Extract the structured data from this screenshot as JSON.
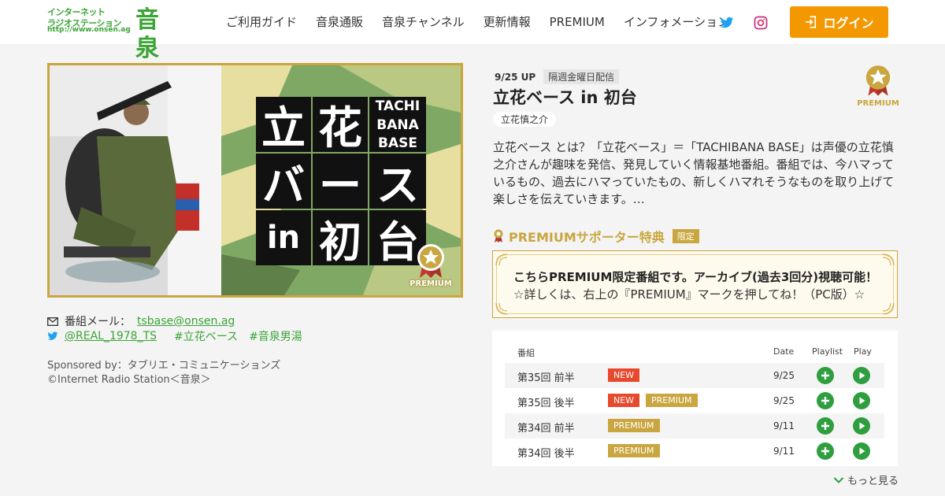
{
  "header": {
    "logo_line1": "インターネット",
    "logo_line2": "ラジオステーション",
    "logo_url": "http://www.onsen.ag",
    "logo_big": "音泉",
    "nav": [
      "ご利用ガイド",
      "音泉通販",
      "音泉チャンネル",
      "更新情報",
      "PREMIUM",
      "インフォメーション"
    ],
    "login_label": "ログイン",
    "icons": [
      "twitter-icon",
      "instagram-icon",
      "login-icon"
    ]
  },
  "hero": {
    "title_chars": [
      "立",
      "花",
      "TACHI",
      "BANA",
      "BASE",
      "バ",
      "ー",
      "ス",
      "in",
      "初",
      "台"
    ],
    "badge_label": "PREMIUM"
  },
  "contact": {
    "mail_label": "番組メール：",
    "mail": "tsbase@onsen.ag",
    "twitter": "@REAL_1978_TS",
    "hashtag1": "#立花ベース",
    "hashtag2": "#音泉男湯"
  },
  "sponsor": {
    "line1": "Sponsored by：タブリエ・コミュニケーションズ",
    "line2": "©Internet Radio Station＜音泉＞"
  },
  "program": {
    "date": "9/25 UP",
    "frequency": "隔週金曜日配信",
    "title": "立花ベース in 初台",
    "cast": "立花慎之介",
    "badge_label": "PREMIUM",
    "description": "立花ベース とは？「立花ベース」＝「TACHIBANA BASE」は声優の立花慎之介さんが趣味を発信、発見していく情報基地番組。番組では、今ハマっているもの、過去にハマっていたもの、新しくハマれそうなものを取り上げて楽しさを伝えていきます。…"
  },
  "premium_supporter": {
    "heading": "PREMIUMサポーター特典",
    "tag": "限定",
    "line1": "こちらPREMIUM限定番組です。アーカイブ(過去3回分)視聴可能！",
    "line2": "☆詳しくは、右上の『PREMIUM』マークを押してね！（PC版）☆"
  },
  "episodes": {
    "headers": {
      "name": "番組",
      "date": "Date",
      "playlist": "Playlist",
      "play": "Play"
    },
    "rows": [
      {
        "name": "第35回 前半",
        "new": "NEW",
        "premium": "",
        "date": "9/25"
      },
      {
        "name": "第35回 後半",
        "new": "NEW",
        "premium": "PREMIUM",
        "date": "9/25"
      },
      {
        "name": "第34回 前半",
        "new": "",
        "premium": "PREMIUM",
        "date": "9/11"
      },
      {
        "name": "第34回 後半",
        "new": "",
        "premium": "PREMIUM",
        "date": "9/11"
      }
    ],
    "more": "もっと見る"
  },
  "colors": {
    "brand_green": "#3aa535",
    "accent_orange": "#f39800",
    "premium_gold": "#c9a63f",
    "new_red": "#e8492d",
    "play_green": "#2e9e3f"
  }
}
